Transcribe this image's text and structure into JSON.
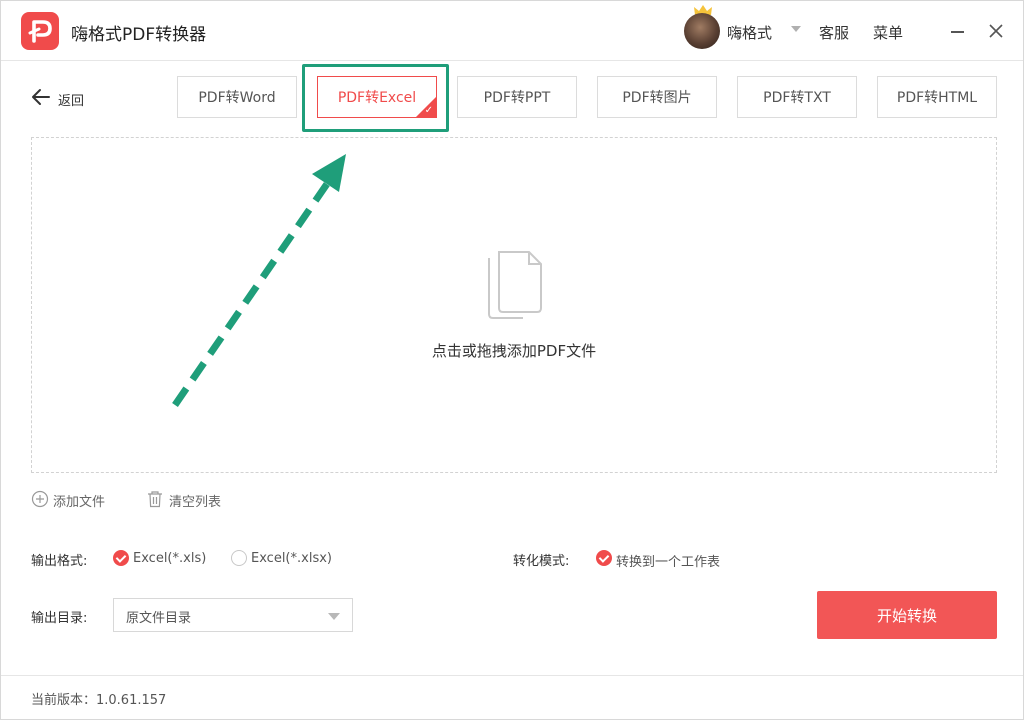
{
  "titlebar": {
    "app_title": "嗨格式PDF转换器",
    "username": "嗨格式",
    "service_label": "客服",
    "menu_label": "菜单"
  },
  "nav": {
    "back_label": "返回"
  },
  "tabs": [
    {
      "label": "PDF转Word",
      "active": false
    },
    {
      "label": "PDF转Excel",
      "active": true
    },
    {
      "label": "PDF转PPT",
      "active": false
    },
    {
      "label": "PDF转图片",
      "active": false
    },
    {
      "label": "PDF转TXT",
      "active": false
    },
    {
      "label": "PDF转HTML",
      "active": false
    }
  ],
  "dropzone": {
    "hint": "点击或拖拽添加PDF文件"
  },
  "file_actions": {
    "add_label": "添加文件",
    "clear_label": "清空列表"
  },
  "settings": {
    "output_format_label": "输出格式:",
    "format_options": [
      {
        "label": "Excel(*.xls)",
        "selected": true
      },
      {
        "label": "Excel(*.xlsx)",
        "selected": false
      }
    ],
    "conversion_mode_label": "转化模式:",
    "mode_option": {
      "label": "转换到一个工作表",
      "selected": true
    },
    "output_dir_label": "输出目录:",
    "output_dir_value": "原文件目录"
  },
  "start_button_label": "开始转换",
  "footer": {
    "version": "当前版本：1.0.61.157"
  },
  "colors": {
    "accent": "#f04b4b",
    "highlight": "#1f9e7a"
  }
}
